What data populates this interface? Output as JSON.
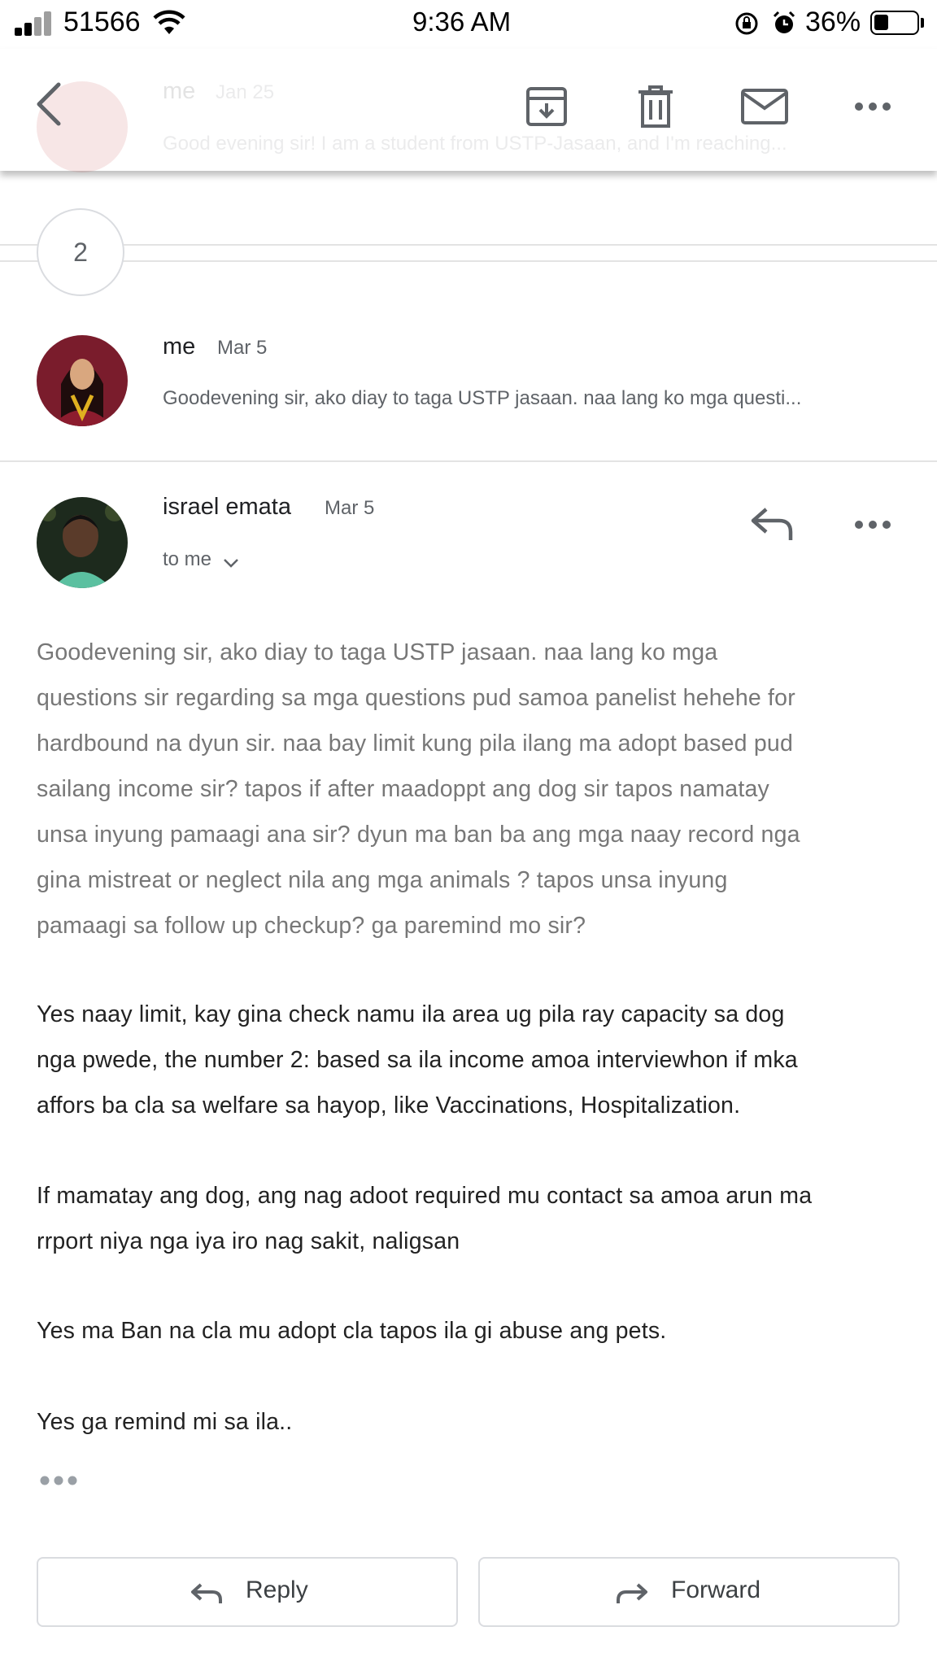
{
  "status_bar": {
    "carrier": "51566",
    "time": "9:36 AM",
    "battery": "36%"
  },
  "toolbar": {
    "prev_sender": "me",
    "prev_date": "Jan 25",
    "prev_snippet": "Good evening sir! I am a student from USTP-Jasaan, and I'm reaching...",
    "icons": [
      "back-icon",
      "archive-icon",
      "delete-icon",
      "mail-icon",
      "more-icon"
    ]
  },
  "collapsed_count": "2",
  "messages": [
    {
      "sender": "me",
      "date": "Mar 5",
      "snippet": "Goodevening sir, ako diay to taga USTP jasaan. naa lang ko mga questi..."
    },
    {
      "sender": "israel emata",
      "date": "Mar 5",
      "recipient": "to me"
    }
  ],
  "email_body": {
    "quoted_lines": [
      "Goodevening sir, ako diay to taga USTP jasaan. naa lang ko mga",
      "questions sir regarding sa mga questions pud samoa panelist hehehe for",
      "hardbound na dyun sir. naa bay limit kung pila ilang ma adopt based pud",
      "sailang income sir? tapos if after maadoppt ang dog sir tapos namatay",
      "unsa inyung pamaagi ana sir? dyun ma ban ba ang mga naay record nga",
      "gina mistreat or neglect nila ang mga animals ? tapos unsa inyung",
      "pamaagi sa follow up checkup? ga paremind mo sir?"
    ],
    "reply_paragraphs": [
      [
        "Yes naay limit, kay gina check namu ila area ug pila ray capacity sa dog",
        "nga pwede, the  number 2:  based sa ila income amoa interviewhon if mka",
        "affors ba cla sa welfare sa hayop, like Vaccinations, Hospitalization."
      ],
      [
        "If mamatay ang dog, ang nag adoot required mu contact sa amoa arun ma",
        "rrport niya nga iya iro nag sakit, naligsan"
      ],
      [
        "Yes ma Ban na cla mu adopt cla tapos ila gi abuse ang pets."
      ],
      [
        "Yes ga remind mi sa ila.."
      ]
    ]
  },
  "actions": {
    "reply_label": "Reply",
    "forward_label": "Forward"
  },
  "colors": {
    "quoted_text": "#777777",
    "body_text": "#222222",
    "icon_gray": "#5f6368",
    "divider": "#e3e3e3"
  }
}
